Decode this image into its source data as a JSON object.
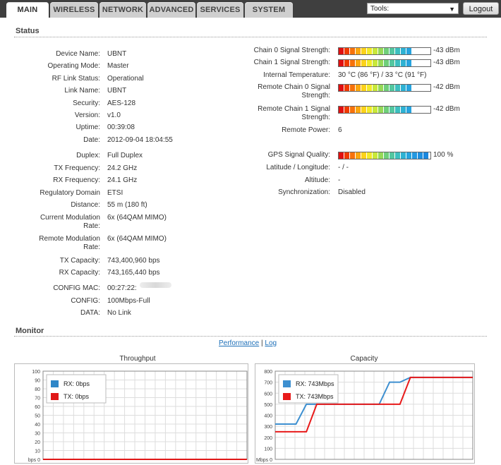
{
  "tabs": [
    {
      "label": "MAIN",
      "active": true
    },
    {
      "label": "WIRELESS"
    },
    {
      "label": "NETWORK"
    },
    {
      "label": "ADVANCED"
    },
    {
      "label": "SERVICES"
    },
    {
      "label": "SYSTEM"
    }
  ],
  "tools": {
    "selected": "Tools:"
  },
  "logout_label": "Logout",
  "status_title": "Status",
  "monitor_title": "Monitor",
  "left_fields": [
    {
      "label": "Device Name:",
      "value": "UBNT"
    },
    {
      "label": "Operating Mode:",
      "value": "Master"
    },
    {
      "label": "RF Link Status:",
      "value": "Operational"
    },
    {
      "label": "Link Name:",
      "value": "UBNT"
    },
    {
      "label": "Security:",
      "value": "AES-128"
    },
    {
      "label": "Version:",
      "value": "v1.0"
    },
    {
      "label": "Uptime:",
      "value": "00:39:08"
    },
    {
      "label": "Date:",
      "value": "2012-09-04 18:04:55"
    },
    {
      "label": "Duplex:",
      "value": "Full Duplex"
    },
    {
      "label": "TX Frequency:",
      "value": "24.2 GHz"
    },
    {
      "label": "RX Frequency:",
      "value": "24.1 GHz"
    },
    {
      "label": "Regulatory Domain",
      "value": "ETSI"
    },
    {
      "label": "Distance:",
      "value": "55 m (180 ft)"
    },
    {
      "label": "Current Modulation Rate:",
      "value": "6x (64QAM MIMO)"
    },
    {
      "label": "Remote Modulation Rate:",
      "value": "6x (64QAM MIMO)"
    },
    {
      "label": "TX Capacity:",
      "value": "743,400,960 bps"
    },
    {
      "label": "RX Capacity:",
      "value": "743,165,440 bps"
    },
    {
      "label": "CONFIG MAC:",
      "value": "00:27:22:"
    },
    {
      "label": "CONFIG:",
      "value": "100Mbps-Full"
    },
    {
      "label": "DATA:",
      "value": "No Link"
    }
  ],
  "right_fields": [
    {
      "label": "Chain 0 Signal Strength:",
      "value": "-43 dBm",
      "meter": 0.82
    },
    {
      "label": "Chain 1 Signal Strength:",
      "value": "-43 dBm",
      "meter": 0.82
    },
    {
      "label": "Internal Temperature:",
      "value": "30 °C (86 °F) / 33 °C (91 °F)"
    },
    {
      "label": "Remote Chain 0 Signal Strength:",
      "value": "-42 dBm",
      "meter": 0.84
    },
    {
      "label": "Remote Chain 1 Signal Strength:",
      "value": "-42 dBm",
      "meter": 0.84
    },
    {
      "label": "Remote Power:",
      "value": "6"
    },
    {
      "label": "GPS Signal Quality:",
      "value": "100 %",
      "meter": 1.0
    },
    {
      "label": "Latitude / Longitude:",
      "value": "- / -"
    },
    {
      "label": "Altitude:",
      "value": "-"
    },
    {
      "label": "Synchronization:",
      "value": "Disabled"
    }
  ],
  "monitor_links": {
    "performance": "Performance",
    "separator": "|",
    "log": "Log"
  },
  "meter_colors": [
    "#e01010",
    "#f03b00",
    "#f7720a",
    "#fba70f",
    "#fcd21a",
    "#f2ea28",
    "#c9e83a",
    "#96d957",
    "#6fcf7a",
    "#54c7a0",
    "#3cbfbf",
    "#2fb2d3",
    "#27a4df",
    "#2498e0",
    "#1f90e0",
    "#1b87de"
  ],
  "chart_data": [
    {
      "type": "line",
      "title": "Throughput",
      "ylim": [
        0,
        100
      ],
      "yticks": [
        "100",
        "90",
        "80",
        "70",
        "60",
        "50",
        "40",
        "30",
        "20",
        "10",
        "bps 0"
      ],
      "legend_placement": "top-left",
      "grid": true,
      "x": [
        0,
        1,
        2,
        3,
        4,
        5,
        6,
        7,
        8,
        9,
        10,
        11,
        12,
        13,
        14,
        15,
        16,
        17,
        18,
        19
      ],
      "series": [
        {
          "name": "RX: 0bps",
          "color": "#2e86c8",
          "values": [
            0,
            0,
            0,
            0,
            0,
            0,
            0,
            0,
            0,
            0,
            0,
            0,
            0,
            0,
            0,
            0,
            0,
            0,
            0,
            0
          ]
        },
        {
          "name": "TX: 0bps",
          "color": "#e01818",
          "values": [
            0,
            0,
            0,
            0,
            0,
            0,
            0,
            0,
            0,
            0,
            0,
            0,
            0,
            0,
            0,
            0,
            0,
            0,
            0,
            0
          ]
        }
      ]
    },
    {
      "type": "line",
      "title": "Capacity",
      "ylim": [
        0,
        800
      ],
      "yticks": [
        "800",
        "700",
        "600",
        "500",
        "400",
        "300",
        "200",
        "100",
        "Mbps 0"
      ],
      "legend_placement": "top-left",
      "grid": true,
      "x": [
        0,
        1,
        2,
        3,
        4,
        5,
        6,
        7,
        8,
        9,
        10,
        11,
        12,
        13,
        14,
        15,
        16,
        17,
        18,
        19
      ],
      "series": [
        {
          "name": "RX: 743Mbps",
          "color": "#3d8fd0",
          "values": [
            320,
            320,
            320,
            500,
            500,
            500,
            500,
            500,
            500,
            500,
            500,
            700,
            700,
            743,
            743,
            743,
            743,
            743,
            743,
            743
          ]
        },
        {
          "name": "TX: 743Mbps",
          "color": "#e81a1a",
          "values": [
            250,
            250,
            250,
            250,
            500,
            500,
            500,
            500,
            500,
            500,
            500,
            500,
            500,
            743,
            743,
            743,
            743,
            743,
            743,
            743
          ]
        }
      ]
    }
  ]
}
